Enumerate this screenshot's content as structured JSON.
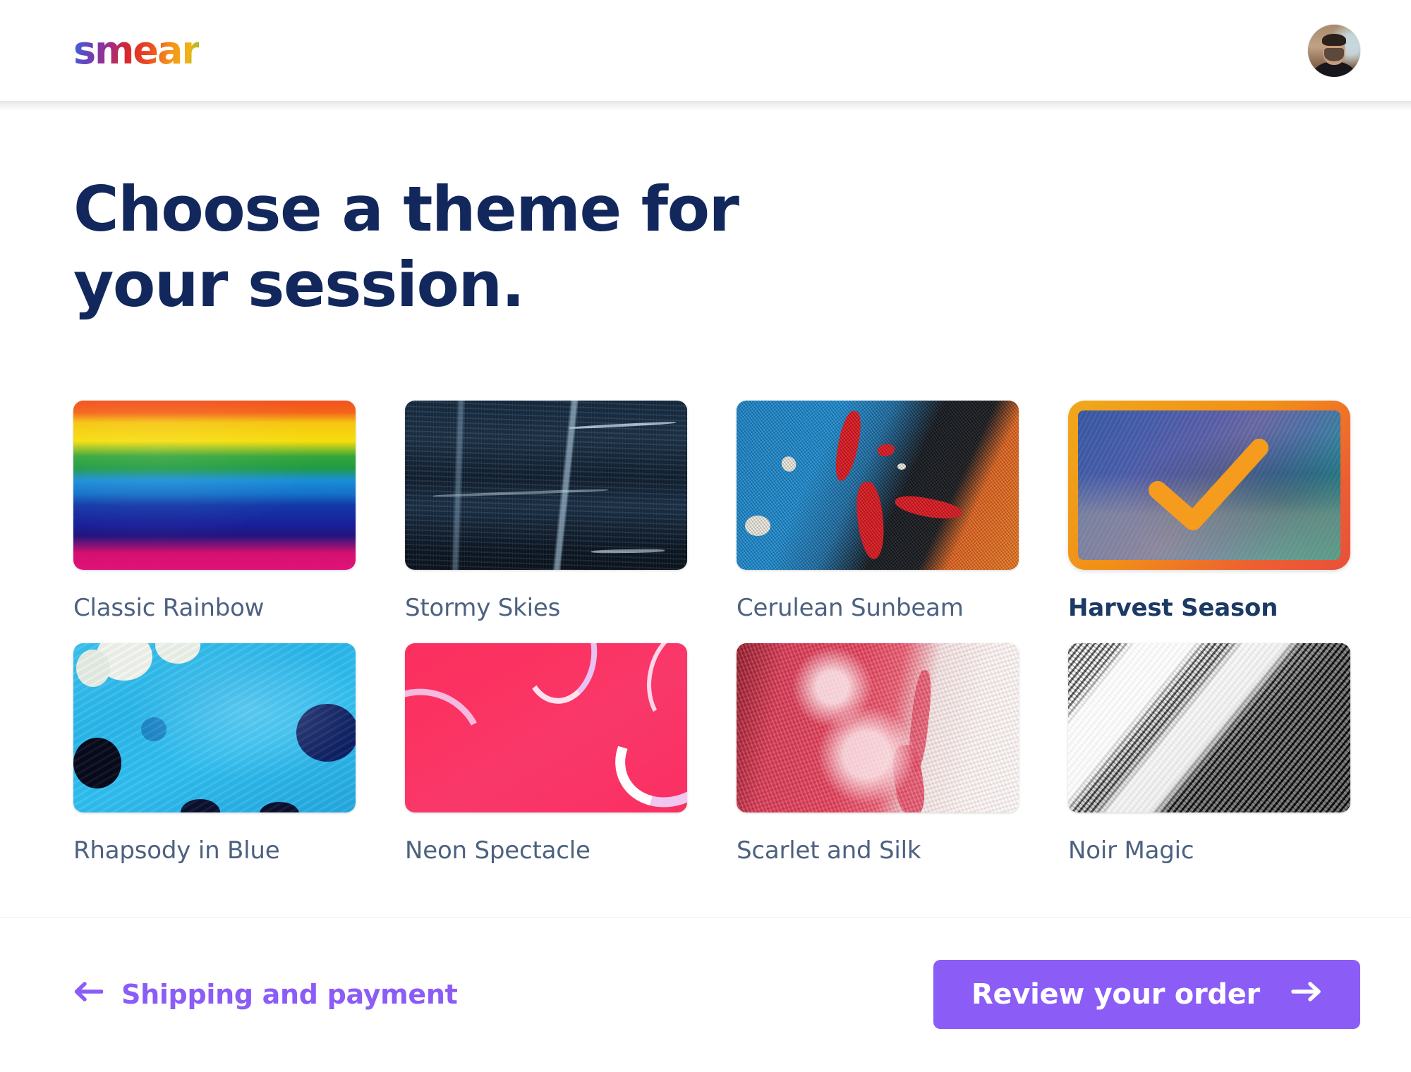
{
  "header": {
    "logo_text": "smear",
    "avatar_alt": "user-avatar"
  },
  "main": {
    "title": "Choose a theme for your session.",
    "title_line1": "Choose a theme for",
    "title_line2": "your session.",
    "selected_theme": "Harvest Season",
    "themes": [
      {
        "label": "Classic Rainbow",
        "art": "art-rainbow",
        "selected": false
      },
      {
        "label": "Stormy Skies",
        "art": "art-stormy",
        "selected": false
      },
      {
        "label": "Cerulean Sunbeam",
        "art": "art-cerulean",
        "selected": false
      },
      {
        "label": "Harvest Season",
        "art": "art-harvest",
        "selected": true
      },
      {
        "label": "Rhapsody in Blue",
        "art": "art-rhapsody",
        "selected": false
      },
      {
        "label": "Neon Spectacle",
        "art": "art-neon",
        "selected": false
      },
      {
        "label": "Scarlet and Silk",
        "art": "art-scarlet",
        "selected": false
      },
      {
        "label": "Noir Magic",
        "art": "art-noir",
        "selected": false
      }
    ]
  },
  "footer": {
    "back_label": "Shipping and payment",
    "back_icon": "arrow-left-icon",
    "cta_label": "Review your order",
    "cta_icon": "arrow-right-icon"
  },
  "colors": {
    "heading": "#12285c",
    "label": "#4d6180",
    "label_selected": "#1c3a63",
    "accent_purple": "#8b5cf6",
    "selection_orange": "#f0a81b",
    "selection_orange_end": "#e8503a",
    "background": "#ffffff"
  }
}
